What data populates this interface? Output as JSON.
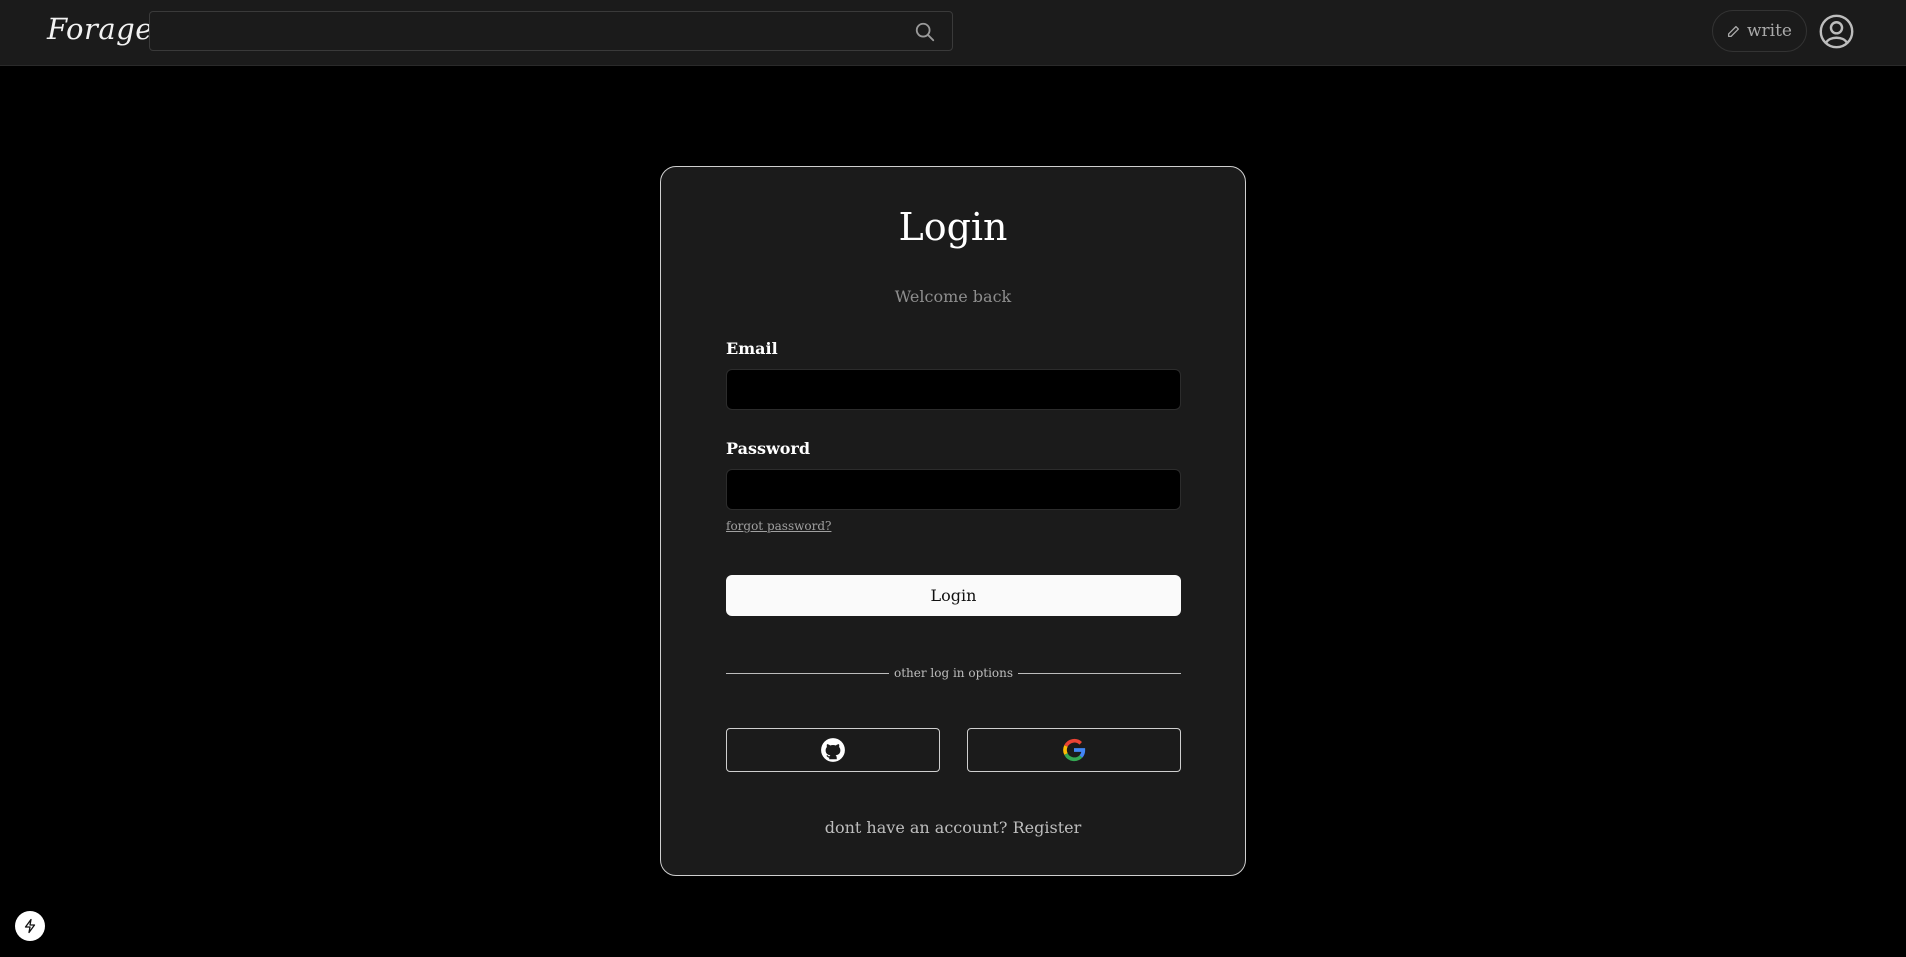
{
  "header": {
    "logo": "Forage",
    "search": {
      "value": "",
      "placeholder": ""
    },
    "write_label": "write"
  },
  "card": {
    "title": "Login",
    "subtitle": "Welcome back",
    "email_label": "Email",
    "email_value": "",
    "password_label": "Password",
    "password_value": "",
    "forgot_label": "forgot password?",
    "login_button": "Login",
    "divider_text": "other log in options",
    "register_prompt": "dont have an account?",
    "register_link": "Register"
  },
  "icons": {
    "search": "search-icon",
    "write": "pencil-icon",
    "profile": "user-circle-icon",
    "github": "github-icon",
    "google": "google-icon",
    "badge": "lightning-icon"
  },
  "colors": {
    "background": "#000000",
    "surface": "#1b1b1b",
    "card_border": "#cfcfcf",
    "primary_button": "#fafafa",
    "muted_text": "#8e8e8e"
  }
}
